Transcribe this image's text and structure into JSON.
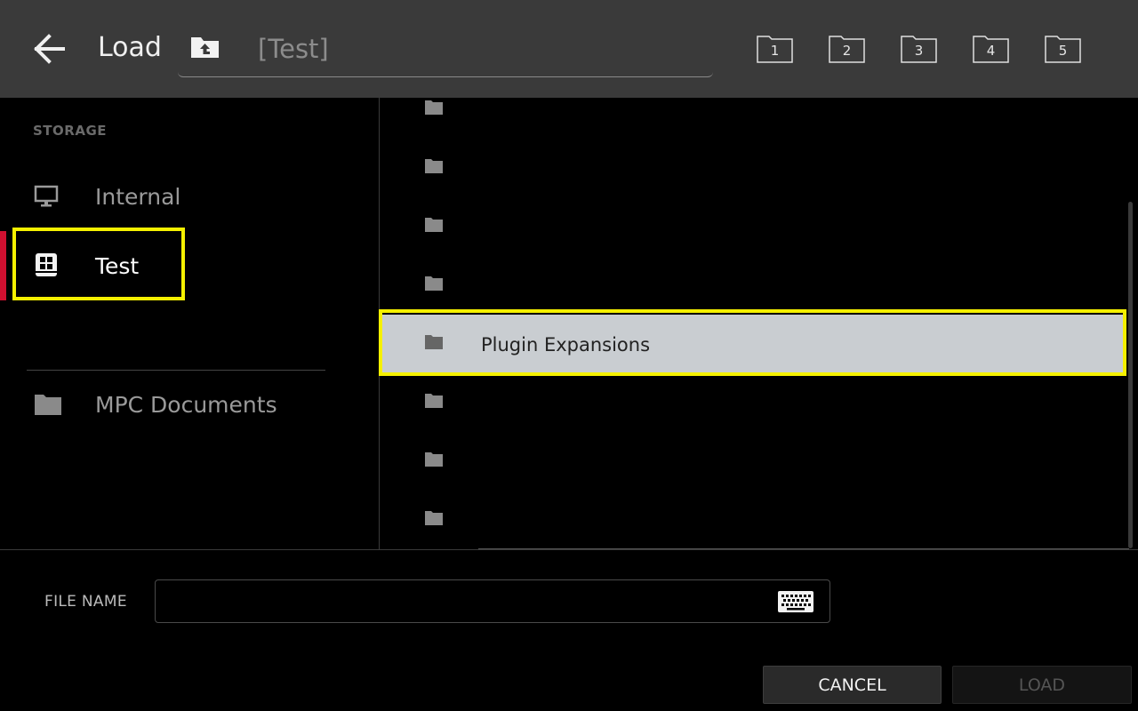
{
  "header": {
    "title": "Load",
    "path": "[Test]",
    "bookmarks": [
      {
        "label": "1"
      },
      {
        "label": "2"
      },
      {
        "label": "3"
      },
      {
        "label": "4"
      },
      {
        "label": "5"
      }
    ]
  },
  "sidebar": {
    "section_label": "STORAGE",
    "items": [
      {
        "label": "Internal",
        "icon": "monitor-icon"
      },
      {
        "label": "Test",
        "icon": "storage-drive-icon",
        "active": true
      }
    ],
    "locations": [
      {
        "label": "MPC Documents",
        "icon": "folder-icon"
      }
    ]
  },
  "filelist": {
    "rows": [
      {
        "name": ""
      },
      {
        "name": ""
      },
      {
        "name": ""
      },
      {
        "name": ""
      },
      {
        "name": "Plugin Expansions",
        "selected": true
      },
      {
        "name": ""
      },
      {
        "name": ""
      },
      {
        "name": ""
      }
    ]
  },
  "footer": {
    "file_name_label": "FILE NAME",
    "file_name_value": "",
    "cancel_label": "CANCEL",
    "load_label": "LOAD"
  },
  "colors": {
    "header_bg": "#3a3a3a",
    "focus_yellow": "#f5f000",
    "active_red": "#d01030",
    "selected_row_bg": "#c9cdd1"
  }
}
